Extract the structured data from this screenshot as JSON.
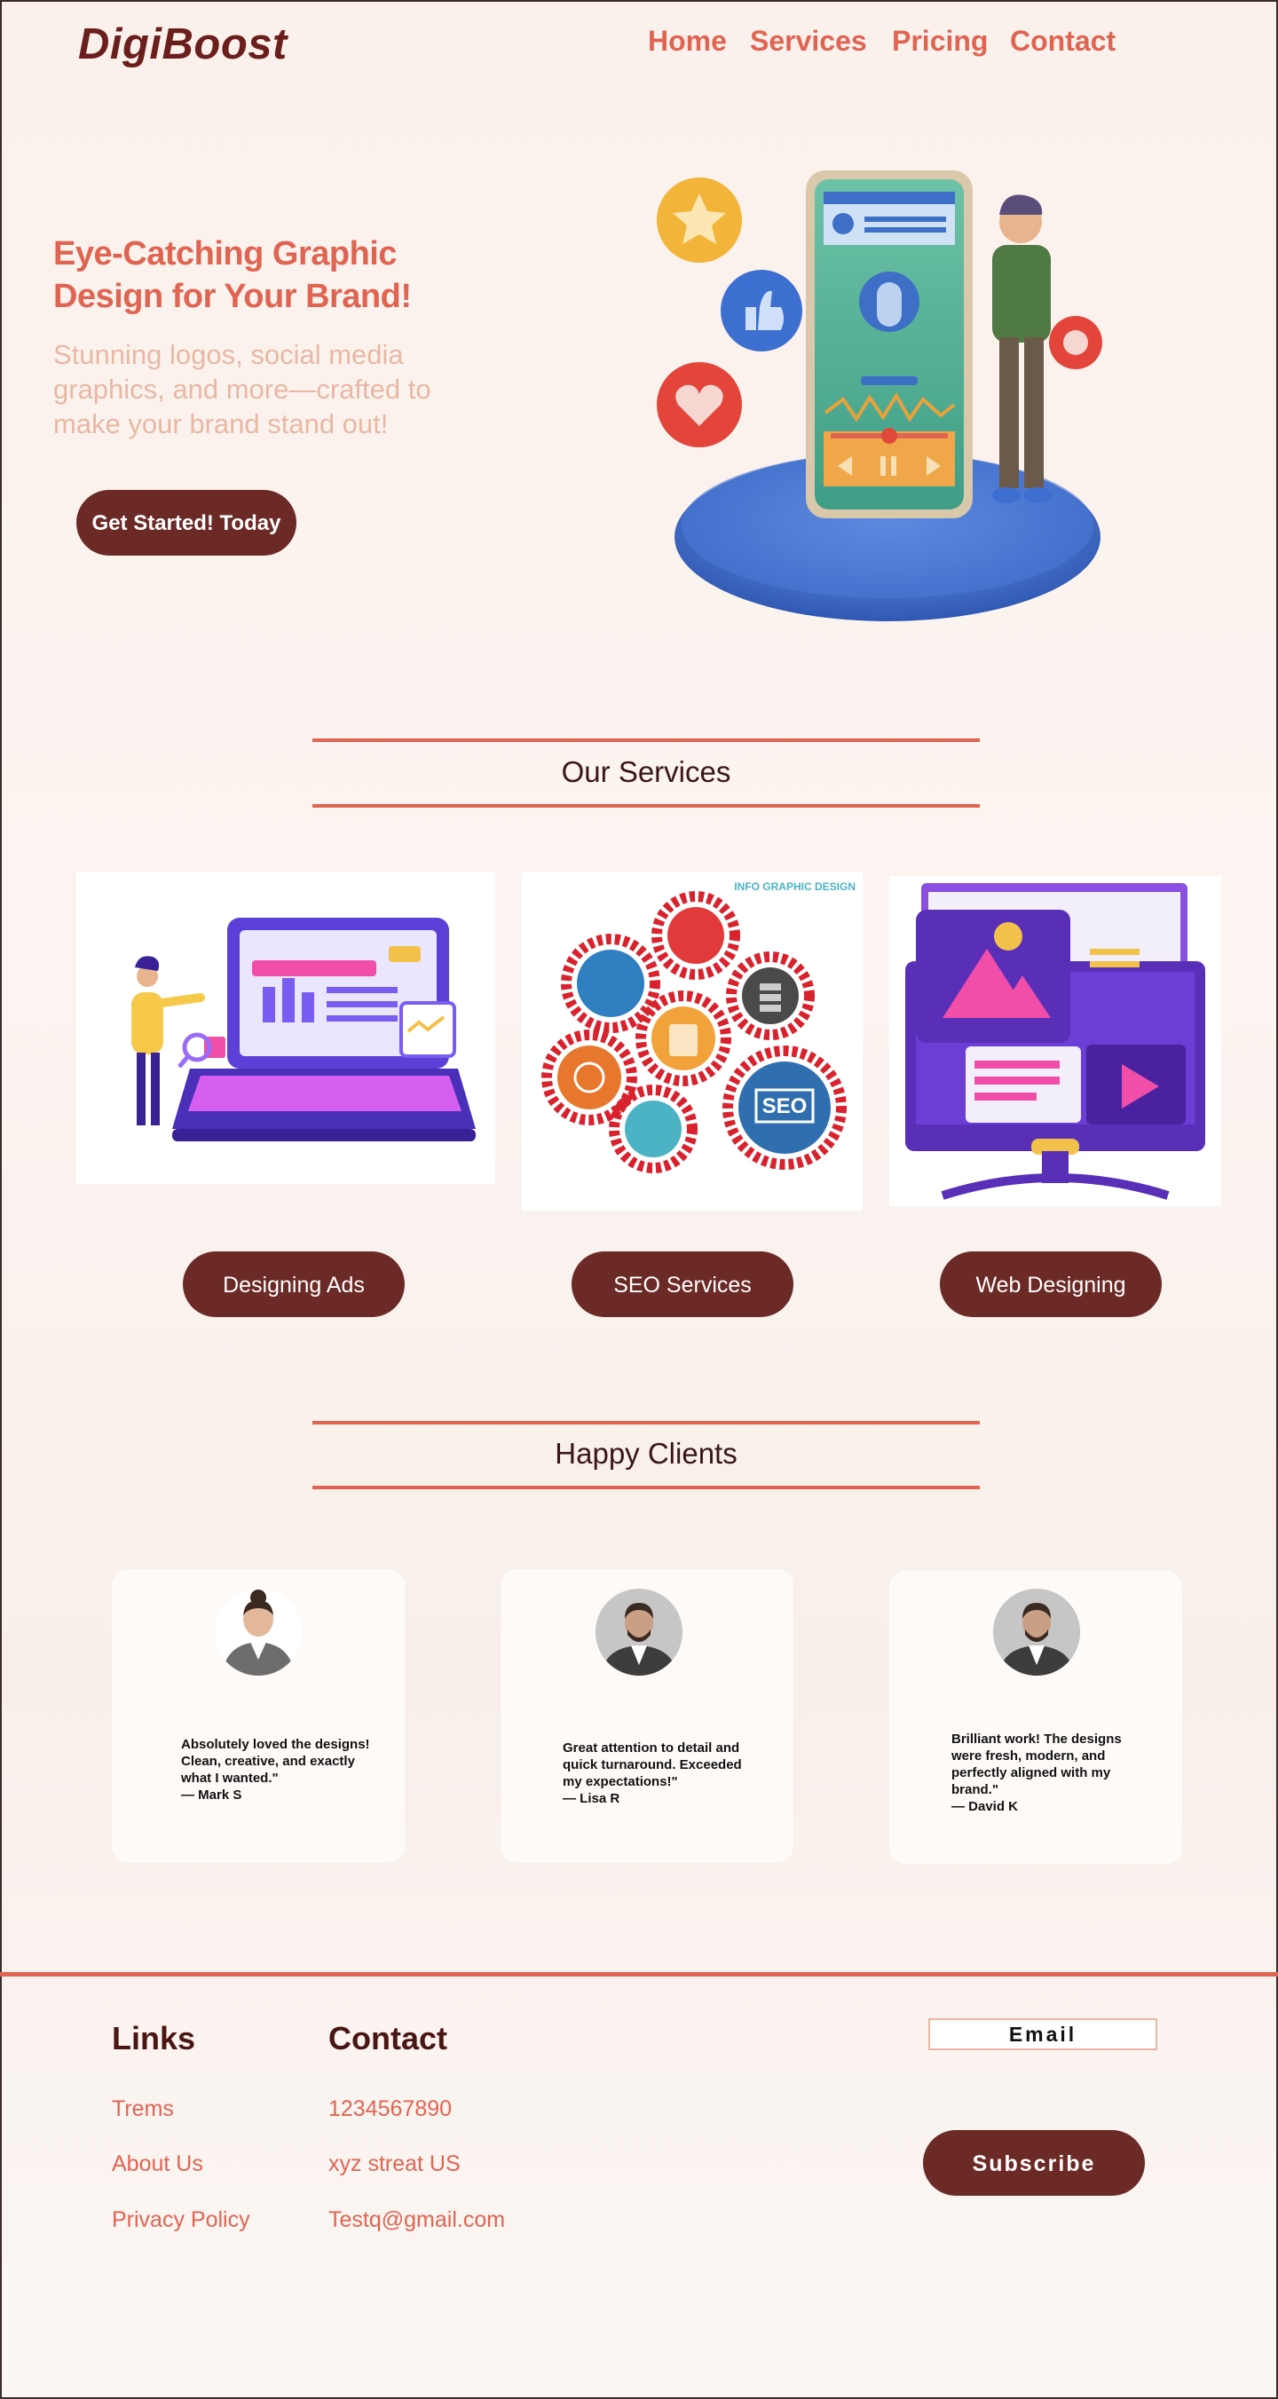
{
  "header": {
    "logo": "DigiBoost",
    "nav": [
      "Home",
      "Services",
      "Pricing",
      "Contact"
    ]
  },
  "hero": {
    "title": "Eye-Catching Graphic Design for Your Brand!",
    "subtitle": "Stunning logos, social media graphics, and more—crafted to make your brand stand out!",
    "cta": "Get Started! Today"
  },
  "services": {
    "heading": "Our Services",
    "seo_image_caption": "INFO GRAPHIC DESIGN",
    "seo_badge": "SEO",
    "items": [
      "Designing Ads",
      "SEO Services",
      "Web Designing"
    ]
  },
  "clients": {
    "heading": "Happy Clients",
    "testimonials": [
      {
        "quote": "Absolutely loved the designs! Clean, creative, and exactly what I wanted.\"",
        "author": "— Mark S"
      },
      {
        "quote": "Great attention to detail and quick turnaround. Exceeded my expectations!\"",
        "author": "— Lisa R"
      },
      {
        "quote": "Brilliant work! The designs were fresh, modern, and perfectly aligned with my brand.\"",
        "author": "— David K"
      }
    ]
  },
  "footer": {
    "links_heading": "Links",
    "links": [
      "Trems",
      "About Us",
      "Privacy Policy"
    ],
    "contact_heading": "Contact",
    "contact": [
      "1234567890",
      "xyz streat US",
      "Testq@gmail.com"
    ],
    "email_placeholder": "Email",
    "subscribe": "Subscribe"
  },
  "colors": {
    "accent": "#e06452",
    "brand_dark": "#6b2a26",
    "logo": "#6b1f1c",
    "background": "#fbf3ef"
  }
}
